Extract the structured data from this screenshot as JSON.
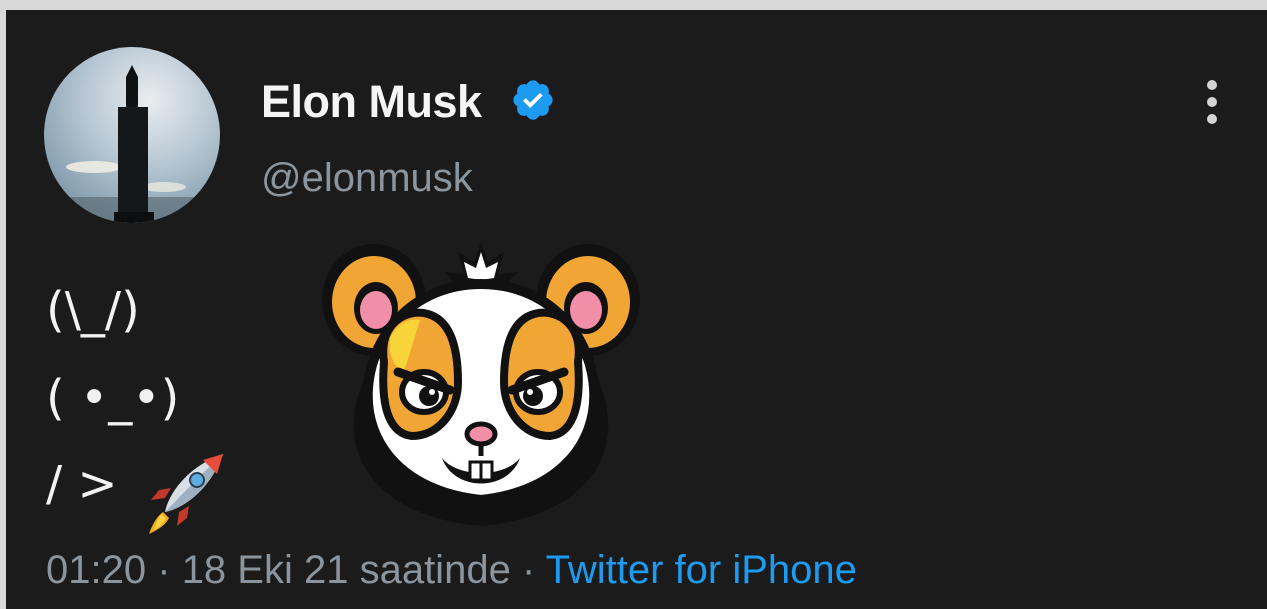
{
  "tweet": {
    "display_name": "Elon Musk",
    "handle": "@elonmusk",
    "verified": true,
    "body_lines": [
      "(\\_/)",
      "( •_•)",
      "/ >"
    ],
    "emoji": "rocket",
    "media_icon": "hamster-face",
    "time": "01:20",
    "separator": "·",
    "date": "18 Eki 21 saatinde",
    "source": "Twitter for iPhone"
  },
  "colors": {
    "background": "#1b1b1b",
    "name": "#f5f5f5",
    "muted": "#8b959e",
    "link": "#1d9bf0",
    "verified": "#1d9bf0"
  },
  "icons": {
    "verified": "verified-badge-icon",
    "more": "more-vertical-icon",
    "rocket": "rocket-icon"
  }
}
